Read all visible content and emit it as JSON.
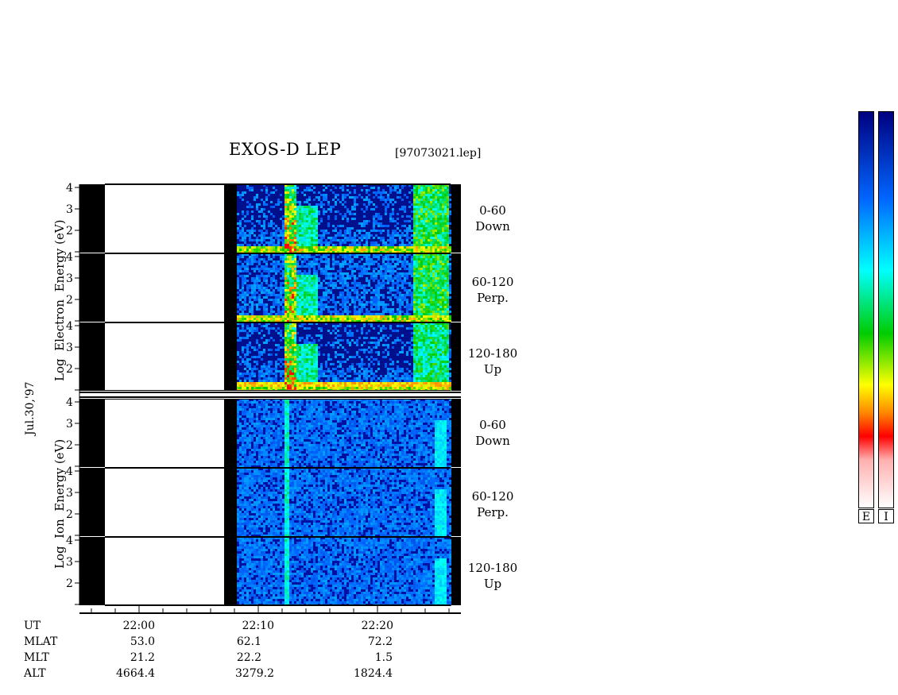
{
  "header": {
    "title": "EXOS-D LEP",
    "filename": "[97073021.lep]"
  },
  "date_label": "Jul.30,'97",
  "y_axis_labels": {
    "electron": [
      "Log",
      "Electron",
      "Energy",
      "(eV)"
    ],
    "ion": [
      "Log",
      "Ion",
      "Energy",
      "(eV)"
    ]
  },
  "channels": {
    "electron": [
      {
        "range": "0-60",
        "dir": "Down"
      },
      {
        "range": "60-120",
        "dir": "Perp."
      },
      {
        "range": "120-180",
        "dir": "Up"
      }
    ],
    "ion": [
      {
        "range": "0-60",
        "dir": "Down"
      },
      {
        "range": "60-120",
        "dir": "Perp."
      },
      {
        "range": "120-180",
        "dir": "Up"
      }
    ]
  },
  "ephemeris": {
    "rows": [
      {
        "label": "UT",
        "values": [
          "22:00",
          "22:10",
          "22:20"
        ]
      },
      {
        "label": "MLAT",
        "values": [
          "53.0",
          "62.1",
          "72.2"
        ]
      },
      {
        "label": "MLT",
        "values": [
          "21.2",
          "22.2",
          "1.5"
        ]
      },
      {
        "label": "ALT",
        "values": [
          "4664.4",
          "3279.2",
          "1824.4"
        ]
      }
    ]
  },
  "colorbar": {
    "labels": [
      "E",
      "I"
    ],
    "colors": [
      "#ffffff",
      "#ff0000",
      "#ff8800",
      "#ffff00",
      "#00cc00",
      "#00ffff",
      "#0066ff",
      "#000080"
    ]
  },
  "chart_data": {
    "type": "heatmap",
    "title": "EXOS-D LEP",
    "xlabel": "UT",
    "ylabel": "Log Energy (eV)",
    "x_ticks": [
      "22:00",
      "22:10",
      "22:20"
    ],
    "y_ticks": [
      "2",
      "3",
      "4"
    ],
    "ylim": [
      1,
      4
    ],
    "panels": [
      {
        "species": "Electron",
        "pitch_angle": "0-60",
        "direction": "Down"
      },
      {
        "species": "Electron",
        "pitch_angle": "60-120",
        "direction": "Perp."
      },
      {
        "species": "Electron",
        "pitch_angle": "120-180",
        "direction": "Up"
      },
      {
        "species": "Ion",
        "pitch_angle": "0-60",
        "direction": "Down"
      },
      {
        "species": "Ion",
        "pitch_angle": "60-120",
        "direction": "Perp."
      },
      {
        "species": "Ion",
        "pitch_angle": "120-180",
        "direction": "Up"
      }
    ],
    "no_data_intervals_ut": [
      [
        "21:55",
        "22:09"
      ],
      [
        "22:26",
        "22:27"
      ]
    ]
  }
}
